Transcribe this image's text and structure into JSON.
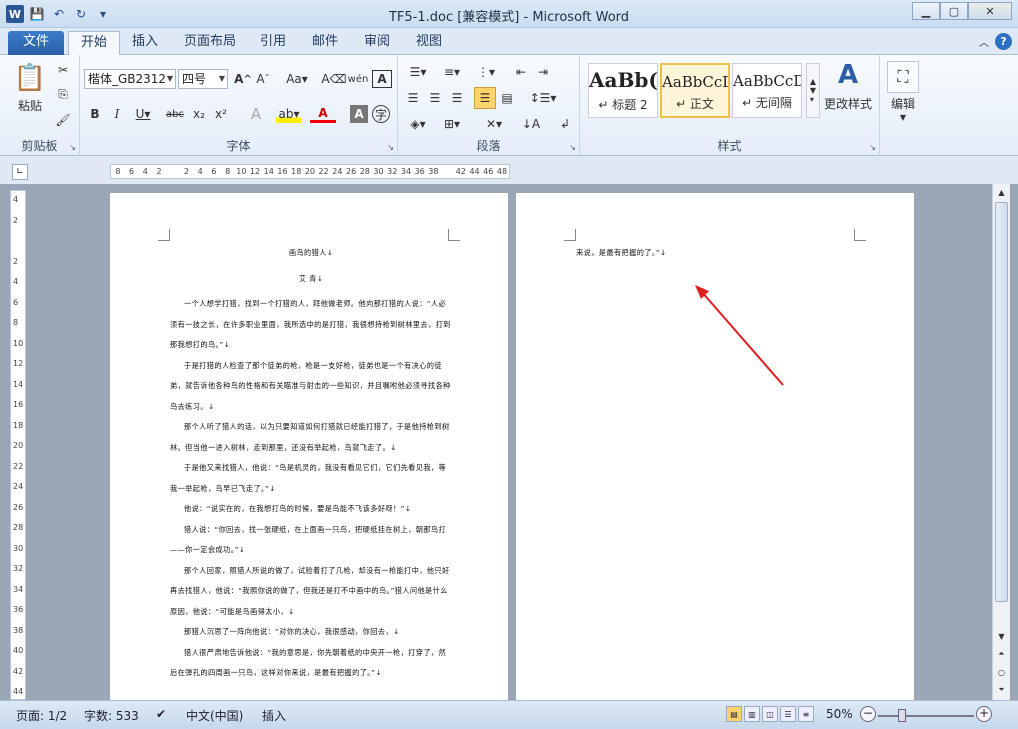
{
  "window": {
    "title": "TF5-1.doc [兼容模式] - Microsoft Word"
  },
  "tabs": [
    {
      "label": "文件"
    },
    {
      "label": "开始"
    },
    {
      "label": "插入"
    },
    {
      "label": "页面布局"
    },
    {
      "label": "引用"
    },
    {
      "label": "邮件"
    },
    {
      "label": "审阅"
    },
    {
      "label": "视图"
    }
  ],
  "ribbon": {
    "clipboard": {
      "label": "剪贴板",
      "paste": "粘贴"
    },
    "font": {
      "label": "字体",
      "family": "楷体_GB2312",
      "size": "四号"
    },
    "paragraph": {
      "label": "段落"
    },
    "styles": {
      "label": "样式",
      "items": [
        {
          "preview": "AaBb(",
          "name": "↵ 标题 2"
        },
        {
          "preview": "AaBbCcDc",
          "name": "↵ 正文"
        },
        {
          "preview": "AaBbCcDc",
          "name": "↵ 无间隔"
        }
      ],
      "change": "更改样式"
    },
    "editing": {
      "label": "编辑"
    }
  },
  "ruler": {
    "h": [
      "8",
      "6",
      "4",
      "2",
      "",
      "2",
      "4",
      "6",
      "8",
      "10",
      "12",
      "14",
      "16",
      "18",
      "20",
      "22",
      "24",
      "26",
      "28",
      "30",
      "32",
      "34",
      "36",
      "38",
      "",
      "42",
      "44",
      "46",
      "48"
    ],
    "v": [
      "4",
      "2",
      "",
      "2",
      "4",
      "6",
      "8",
      "10",
      "12",
      "14",
      "16",
      "18",
      "20",
      "22",
      "24",
      "26",
      "28",
      "30",
      "32",
      "34",
      "36",
      "38",
      "40",
      "42",
      "44"
    ]
  },
  "document": {
    "page1": {
      "title": "画鸟的猎人↓",
      "author": "艾 青↓",
      "paragraphs": [
        "一个人想学打猎，找到一个打猎的人，拜他做老师。他向那打猎的人说：“人必须有一技之长，在许多职业里面，我所选中的是打猎，我很想持枪到树林里去，打到那我想打的鸟。”↓",
        "于是打猎的人检查了那个徒弟的枪，枪是一支好枪，徒弟也是一个有决心的徒弟，就告诉他各种鸟的性格和有关瞄准与射击的一些知识，并且嘱咐他必须寻找各种鸟去练习。↓",
        "那个人听了猎人的话，以为只要知道如何打猎就已经能打猎了，于是他持枪到树林。但当他一进入树林，走到那里，还没有举起枪，鸟就飞走了。↓",
        "于是他又来找猎人，他说：“鸟是机灵的，我没有看见它们，它们先看见我，等我一举起枪，鸟早已飞走了。”↓",
        "他说：“说实在的，在我想打鸟的时候，要是鸟能不飞该多好呀！”↓",
        "猎人说：“你回去，找一张硬纸，在上面画一只鸟，把硬纸挂在树上，朝那鸟打——你一定会成功。”↓",
        "那个人回家，照猎人所说的做了，试验着打了几枪，却没有一枪能打中，他只好再去找猎人，他说：“我照你说的做了，但我还是打不中画中的鸟。”猎人问他是什么原因，他说：“可能是鸟画得太小，↓",
        "那猎人沉思了一阵向他说：“对你的决心，我很感动，你回去，↓",
        "猎人很严肃地告诉他说：“我的意思是，你先朝着纸的中央开一枪，打穿了，然后在弹孔的四周画一只鸟，这样对你来说，是最有把握的了。”↓"
      ]
    },
    "page2": {
      "text": "来说，是最有把握的了。”↓"
    }
  },
  "status": {
    "page": "页面: 1/2",
    "words": "字数: 533",
    "lang": "中文(中国)",
    "mode": "插入",
    "zoom": "50%"
  },
  "colors": {
    "accent": "#2b5797",
    "arrow": "#e02020"
  }
}
